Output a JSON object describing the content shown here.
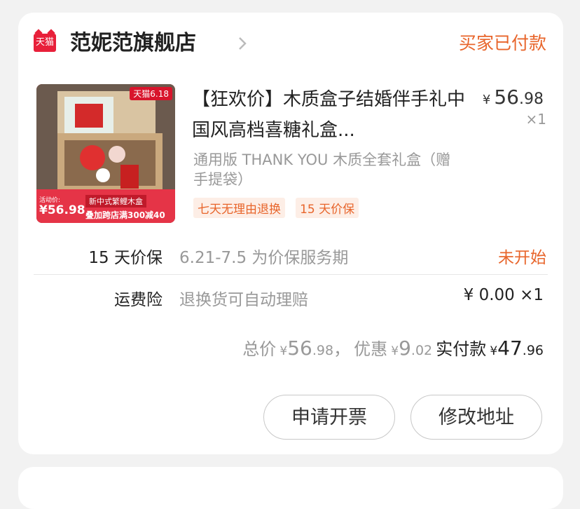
{
  "store": {
    "badge": "天猫",
    "name": "范妮范旗舰店",
    "status": "买家已付款"
  },
  "product": {
    "title": "【狂欢价】木质盒子结婚伴手礼中国风高档喜糖礼盒...",
    "price_currency": "¥",
    "price_int": "56",
    "price_dec": ".98",
    "quantity": "×1",
    "variant": "通用版 THANK YOU 木质全套礼盒（赠手提袋）",
    "tags": [
      "七天无理由退换",
      "15 天价保"
    ],
    "image": {
      "badge": "天猫6.18",
      "activity_label": "活动价:",
      "activity_price": "¥56.98",
      "style_tag": "新中式繁鲤木盒",
      "promo": "叠加跨店满300减40"
    }
  },
  "services": [
    {
      "label": "15 天价保",
      "desc": "6.21-7.5 为价保服务期",
      "status": "未开始"
    },
    {
      "label": "运费险",
      "desc": "退换货可自动理赔",
      "value": "¥ 0.00 ×1"
    }
  ],
  "totals": {
    "total_label": "总价",
    "total_currency": "¥",
    "total_int": "56",
    "total_dec": ".98",
    "sep": "，",
    "discount_label": "优惠",
    "discount_currency": "¥",
    "discount_int": "9",
    "discount_dec": ".02",
    "paid_label": "实付款",
    "paid_currency": "¥",
    "paid_int": "47",
    "paid_dec": ".96"
  },
  "actions": {
    "invoice": "申请开票",
    "edit_address": "修改地址"
  },
  "colors": {
    "accent": "#e8652b",
    "tmall_red": "#e8203a"
  }
}
